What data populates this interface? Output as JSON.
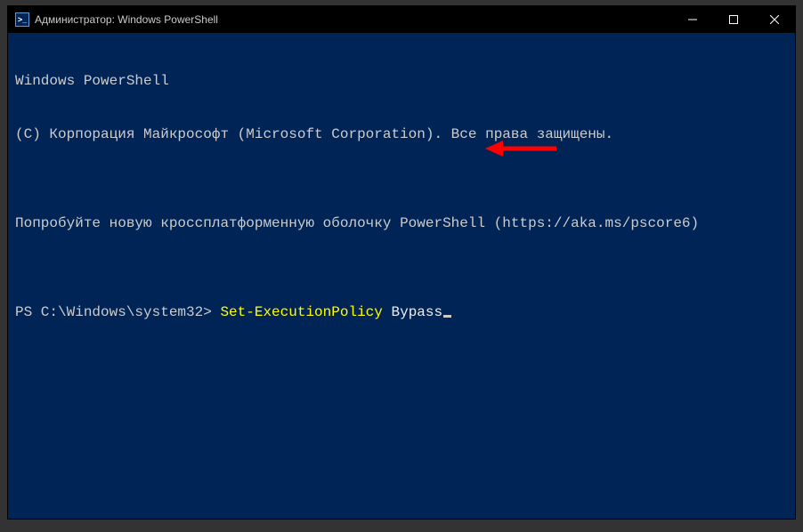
{
  "titlebar": {
    "title": "Администратор: Windows PowerShell",
    "icon_glyph": ">_"
  },
  "terminal": {
    "line1": "Windows PowerShell",
    "line2": "(C) Корпорация Майкрософт (Microsoft Corporation). Все права защищены.",
    "line3": "",
    "line4": "Попробуйте новую кроссплатформенную оболочку PowerShell (https://aka.ms/pscore6)",
    "line5": "",
    "prompt": "PS C:\\Windows\\system32> ",
    "command_part1": "Set-ExecutionPolicy",
    "command_space": " ",
    "command_part2": "Bypass"
  },
  "colors": {
    "terminal_bg": "#012456",
    "prompt_text": "#cccccc",
    "cmdlet": "#ffff00",
    "argument": "#eeeeee",
    "arrow": "#ff0000"
  }
}
